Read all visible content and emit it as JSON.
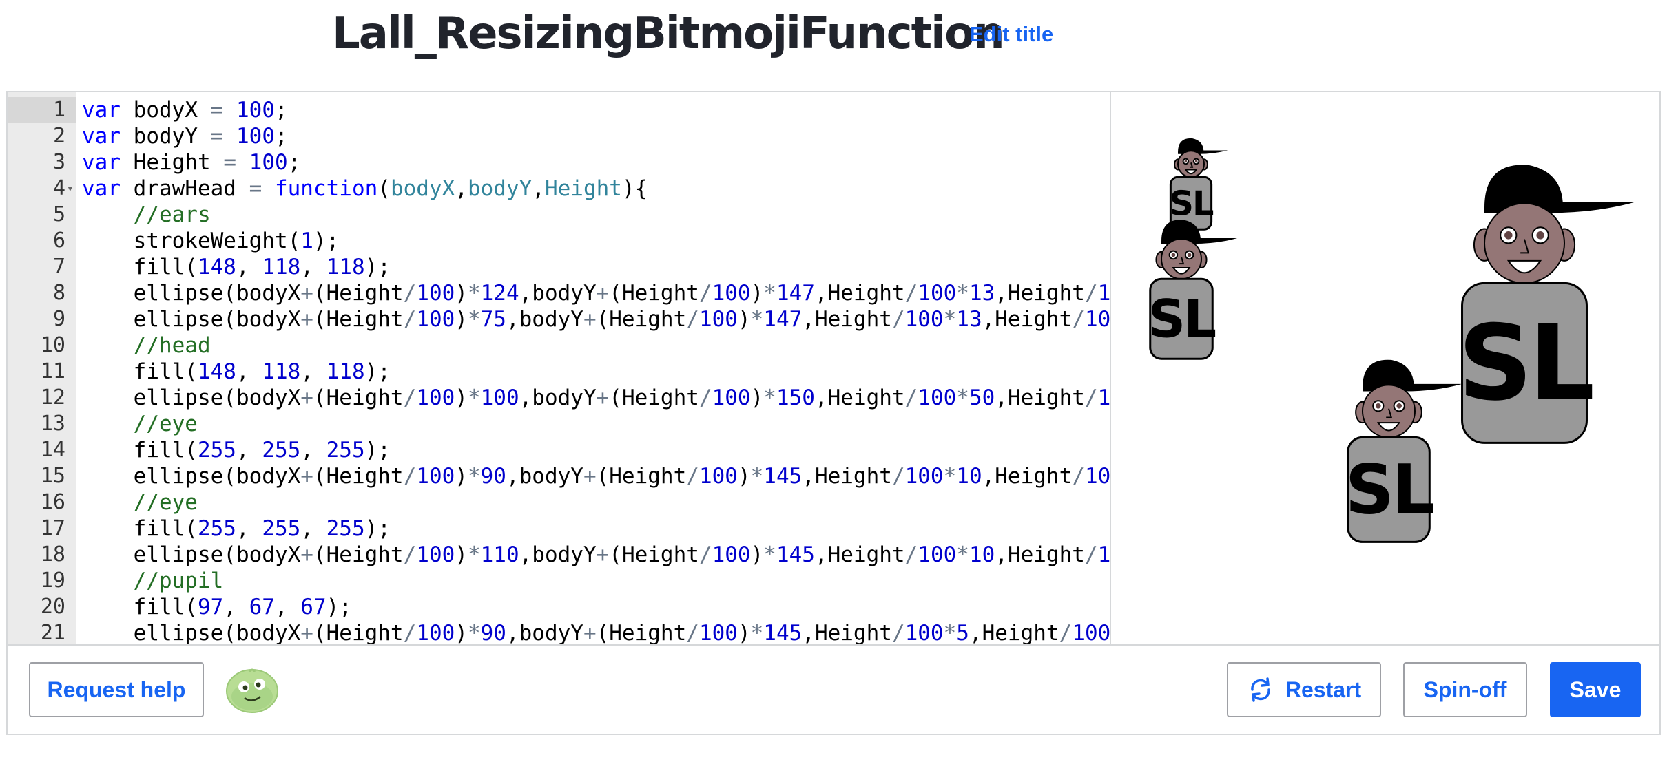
{
  "header": {
    "title": "Lall_ResizingBitmojiFunction",
    "edit_title": "Edit title"
  },
  "editor": {
    "active_line": 1,
    "lines": [
      [
        [
          "kw",
          "var"
        ],
        [
          "t",
          " bodyX "
        ],
        [
          "op",
          "="
        ],
        [
          "t",
          " "
        ],
        [
          "nm",
          "100"
        ],
        [
          "t",
          ";"
        ]
      ],
      [
        [
          "kw",
          "var"
        ],
        [
          "t",
          " bodyY "
        ],
        [
          "op",
          "="
        ],
        [
          "t",
          " "
        ],
        [
          "nm",
          "100"
        ],
        [
          "t",
          ";"
        ]
      ],
      [
        [
          "kw",
          "var"
        ],
        [
          "t",
          " Height "
        ],
        [
          "op",
          "="
        ],
        [
          "t",
          " "
        ],
        [
          "nm",
          "100"
        ],
        [
          "t",
          ";"
        ]
      ],
      [
        [
          "kw",
          "var"
        ],
        [
          "t",
          " drawHead "
        ],
        [
          "op",
          "="
        ],
        [
          "t",
          " "
        ],
        [
          "fn",
          "function"
        ],
        [
          "t",
          "("
        ],
        [
          "pm",
          "bodyX"
        ],
        [
          "t",
          ","
        ],
        [
          "pm",
          "bodyY"
        ],
        [
          "t",
          ","
        ],
        [
          "pm",
          "Height"
        ],
        [
          "t",
          "){"
        ]
      ],
      [
        [
          "t",
          "    "
        ],
        [
          "cm",
          "//ears"
        ]
      ],
      [
        [
          "t",
          "    strokeWeight("
        ],
        [
          "nm",
          "1"
        ],
        [
          "t",
          ");"
        ]
      ],
      [
        [
          "t",
          "    fill("
        ],
        [
          "nm",
          "148"
        ],
        [
          "t",
          ", "
        ],
        [
          "nm",
          "118"
        ],
        [
          "t",
          ", "
        ],
        [
          "nm",
          "118"
        ],
        [
          "t",
          ");"
        ]
      ],
      [
        [
          "t",
          "    ellipse(bodyX"
        ],
        [
          "op",
          "+"
        ],
        [
          "t",
          "(Height"
        ],
        [
          "op",
          "/"
        ],
        [
          "nm",
          "100"
        ],
        [
          "t",
          ")"
        ],
        [
          "op",
          "*"
        ],
        [
          "nm",
          "124"
        ],
        [
          "t",
          ",bodyY"
        ],
        [
          "op",
          "+"
        ],
        [
          "t",
          "(Height"
        ],
        [
          "op",
          "/"
        ],
        [
          "nm",
          "100"
        ],
        [
          "t",
          ")"
        ],
        [
          "op",
          "*"
        ],
        [
          "nm",
          "147"
        ],
        [
          "t",
          ",Height"
        ],
        [
          "op",
          "/"
        ],
        [
          "nm",
          "100"
        ],
        [
          "op",
          "*"
        ],
        [
          "nm",
          "13"
        ],
        [
          "t",
          ",Height"
        ],
        [
          "op",
          "/"
        ],
        [
          "nm",
          "100"
        ],
        [
          "op",
          "*"
        ],
        [
          "nm",
          "20"
        ],
        [
          "t",
          ");"
        ]
      ],
      [
        [
          "t",
          "    ellipse(bodyX"
        ],
        [
          "op",
          "+"
        ],
        [
          "t",
          "(Height"
        ],
        [
          "op",
          "/"
        ],
        [
          "nm",
          "100"
        ],
        [
          "t",
          ")"
        ],
        [
          "op",
          "*"
        ],
        [
          "nm",
          "75"
        ],
        [
          "t",
          ",bodyY"
        ],
        [
          "op",
          "+"
        ],
        [
          "t",
          "(Height"
        ],
        [
          "op",
          "/"
        ],
        [
          "nm",
          "100"
        ],
        [
          "t",
          ")"
        ],
        [
          "op",
          "*"
        ],
        [
          "nm",
          "147"
        ],
        [
          "t",
          ",Height"
        ],
        [
          "op",
          "/"
        ],
        [
          "nm",
          "100"
        ],
        [
          "op",
          "*"
        ],
        [
          "nm",
          "13"
        ],
        [
          "t",
          ",Height"
        ],
        [
          "op",
          "/"
        ],
        [
          "nm",
          "100"
        ],
        [
          "op",
          "*"
        ],
        [
          "nm",
          "20"
        ],
        [
          "t",
          ");"
        ]
      ],
      [
        [
          "t",
          "    "
        ],
        [
          "cm",
          "//head"
        ]
      ],
      [
        [
          "t",
          "    fill("
        ],
        [
          "nm",
          "148"
        ],
        [
          "t",
          ", "
        ],
        [
          "nm",
          "118"
        ],
        [
          "t",
          ", "
        ],
        [
          "nm",
          "118"
        ],
        [
          "t",
          ");"
        ]
      ],
      [
        [
          "t",
          "    ellipse(bodyX"
        ],
        [
          "op",
          "+"
        ],
        [
          "t",
          "(Height"
        ],
        [
          "op",
          "/"
        ],
        [
          "nm",
          "100"
        ],
        [
          "t",
          ")"
        ],
        [
          "op",
          "*"
        ],
        [
          "nm",
          "100"
        ],
        [
          "t",
          ",bodyY"
        ],
        [
          "op",
          "+"
        ],
        [
          "t",
          "(Height"
        ],
        [
          "op",
          "/"
        ],
        [
          "nm",
          "100"
        ],
        [
          "t",
          ")"
        ],
        [
          "op",
          "*"
        ],
        [
          "nm",
          "150"
        ],
        [
          "t",
          ",Height"
        ],
        [
          "op",
          "/"
        ],
        [
          "nm",
          "100"
        ],
        [
          "op",
          "*"
        ],
        [
          "nm",
          "50"
        ],
        [
          "t",
          ",Height"
        ],
        [
          "op",
          "/"
        ],
        [
          "nm",
          "100"
        ],
        [
          "op",
          "*"
        ],
        [
          "nm",
          "50"
        ],
        [
          "t",
          ");"
        ]
      ],
      [
        [
          "t",
          "    "
        ],
        [
          "cm",
          "//eye"
        ]
      ],
      [
        [
          "t",
          "    fill("
        ],
        [
          "nm",
          "255"
        ],
        [
          "t",
          ", "
        ],
        [
          "nm",
          "255"
        ],
        [
          "t",
          ", "
        ],
        [
          "nm",
          "255"
        ],
        [
          "t",
          ");"
        ]
      ],
      [
        [
          "t",
          "    ellipse(bodyX"
        ],
        [
          "op",
          "+"
        ],
        [
          "t",
          "(Height"
        ],
        [
          "op",
          "/"
        ],
        [
          "nm",
          "100"
        ],
        [
          "t",
          ")"
        ],
        [
          "op",
          "*"
        ],
        [
          "nm",
          "90"
        ],
        [
          "t",
          ",bodyY"
        ],
        [
          "op",
          "+"
        ],
        [
          "t",
          "(Height"
        ],
        [
          "op",
          "/"
        ],
        [
          "nm",
          "100"
        ],
        [
          "t",
          ")"
        ],
        [
          "op",
          "*"
        ],
        [
          "nm",
          "145"
        ],
        [
          "t",
          ",Height"
        ],
        [
          "op",
          "/"
        ],
        [
          "nm",
          "100"
        ],
        [
          "op",
          "*"
        ],
        [
          "nm",
          "10"
        ],
        [
          "t",
          ",Height"
        ],
        [
          "op",
          "/"
        ],
        [
          "nm",
          "100"
        ],
        [
          "op",
          "*"
        ],
        [
          "nm",
          "10"
        ],
        [
          "t",
          ");"
        ]
      ],
      [
        [
          "t",
          "    "
        ],
        [
          "cm",
          "//eye"
        ]
      ],
      [
        [
          "t",
          "    fill("
        ],
        [
          "nm",
          "255"
        ],
        [
          "t",
          ", "
        ],
        [
          "nm",
          "255"
        ],
        [
          "t",
          ", "
        ],
        [
          "nm",
          "255"
        ],
        [
          "t",
          ");"
        ]
      ],
      [
        [
          "t",
          "    ellipse(bodyX"
        ],
        [
          "op",
          "+"
        ],
        [
          "t",
          "(Height"
        ],
        [
          "op",
          "/"
        ],
        [
          "nm",
          "100"
        ],
        [
          "t",
          ")"
        ],
        [
          "op",
          "*"
        ],
        [
          "nm",
          "110"
        ],
        [
          "t",
          ",bodyY"
        ],
        [
          "op",
          "+"
        ],
        [
          "t",
          "(Height"
        ],
        [
          "op",
          "/"
        ],
        [
          "nm",
          "100"
        ],
        [
          "t",
          ")"
        ],
        [
          "op",
          "*"
        ],
        [
          "nm",
          "145"
        ],
        [
          "t",
          ",Height"
        ],
        [
          "op",
          "/"
        ],
        [
          "nm",
          "100"
        ],
        [
          "op",
          "*"
        ],
        [
          "nm",
          "10"
        ],
        [
          "t",
          ",Height"
        ],
        [
          "op",
          "/"
        ],
        [
          "nm",
          "100"
        ],
        [
          "op",
          "*"
        ],
        [
          "nm",
          "10"
        ],
        [
          "t",
          ");"
        ]
      ],
      [
        [
          "t",
          "    "
        ],
        [
          "cm",
          "//pupil"
        ]
      ],
      [
        [
          "t",
          "    fill("
        ],
        [
          "nm",
          "97"
        ],
        [
          "t",
          ", "
        ],
        [
          "nm",
          "67"
        ],
        [
          "t",
          ", "
        ],
        [
          "nm",
          "67"
        ],
        [
          "t",
          ");"
        ]
      ],
      [
        [
          "t",
          "    ellipse(bodyX"
        ],
        [
          "op",
          "+"
        ],
        [
          "t",
          "(Height"
        ],
        [
          "op",
          "/"
        ],
        [
          "nm",
          "100"
        ],
        [
          "t",
          ")"
        ],
        [
          "op",
          "*"
        ],
        [
          "nm",
          "90"
        ],
        [
          "t",
          ",bodyY"
        ],
        [
          "op",
          "+"
        ],
        [
          "t",
          "(Height"
        ],
        [
          "op",
          "/"
        ],
        [
          "nm",
          "100"
        ],
        [
          "t",
          ")"
        ],
        [
          "op",
          "*"
        ],
        [
          "nm",
          "145"
        ],
        [
          "t",
          ",Height"
        ],
        [
          "op",
          "/"
        ],
        [
          "nm",
          "100"
        ],
        [
          "op",
          "*"
        ],
        [
          "nm",
          "5"
        ],
        [
          "t",
          ",Height"
        ],
        [
          "op",
          "/"
        ],
        [
          "nm",
          "100"
        ],
        [
          "op",
          "*"
        ],
        [
          "nm",
          "5"
        ],
        [
          "t",
          ");"
        ]
      ]
    ]
  },
  "canvas": {
    "shirt_text": "SL",
    "colors": {
      "skin": "#947676",
      "shirt": "#999999",
      "cap": "#000000",
      "pupil": "#614343"
    }
  },
  "footer": {
    "request_help": "Request help",
    "restart": "Restart",
    "spinoff": "Spin-off",
    "save": "Save"
  },
  "colors": {
    "accent": "#1865f2"
  }
}
